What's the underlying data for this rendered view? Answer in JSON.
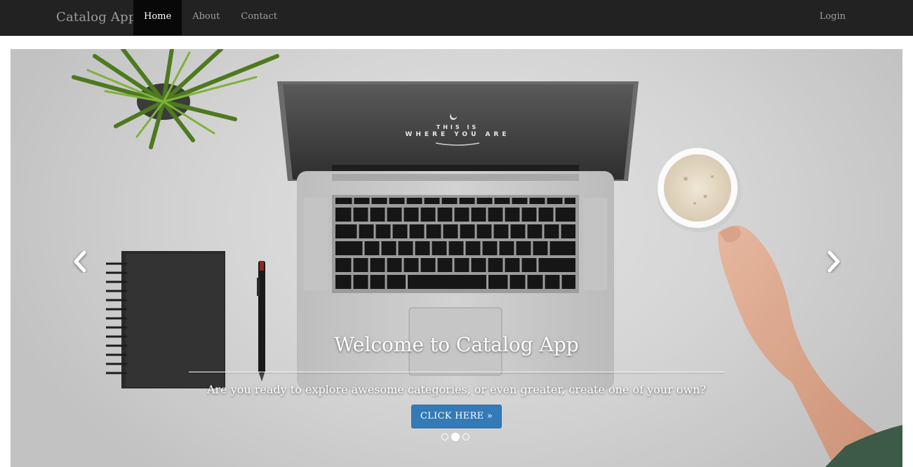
{
  "navbar": {
    "brand": "Catalog App",
    "items": [
      {
        "label": "Home",
        "active": true
      },
      {
        "label": "About",
        "active": false
      },
      {
        "label": "Contact",
        "active": false
      }
    ],
    "login": "Login"
  },
  "carousel": {
    "screen_text_line1": "THIS IS",
    "screen_text_line2": "WHERE YOU ARE",
    "caption_title": "Welcome to Catalog App",
    "caption_text": "Are you ready to explore awesome categories, or even greater, create one of your own?",
    "button_label": "CLICK HERE »",
    "prev_icon": "chevron-left-icon",
    "next_icon": "chevron-right-icon",
    "slide_count": 3,
    "active_slide": 2
  },
  "colors": {
    "navbar_bg": "#222222",
    "nav_active_bg": "#080808",
    "nav_text": "#9d9d9d",
    "button_bg": "#337ab7"
  }
}
